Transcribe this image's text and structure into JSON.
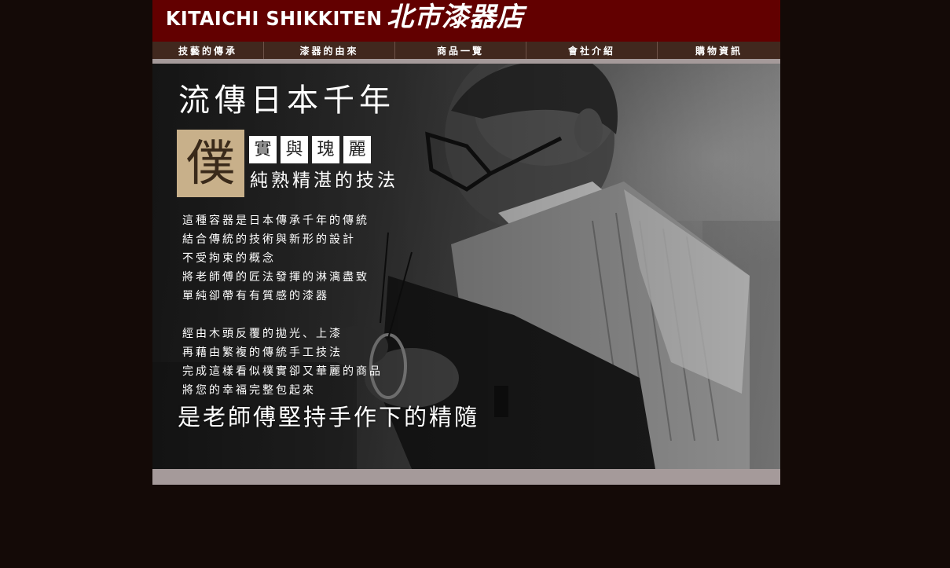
{
  "banner": {
    "brand_en": "KITAICHI SHIKKITEN",
    "brand_jp": "北市漆器店"
  },
  "nav": {
    "items": [
      {
        "label": "技藝的傳承"
      },
      {
        "label": "漆器的由來"
      },
      {
        "label": "商品一覽"
      },
      {
        "label": "會社介紹"
      },
      {
        "label": "購物資訊"
      }
    ]
  },
  "hero": {
    "heading": "流傳日本千年",
    "seal_char": "僕",
    "boxed_chars": [
      "實",
      "與",
      "瑰",
      "麗"
    ],
    "subtitle": "純熟精湛的技法",
    "paragraph1": [
      "這種容器是日本傳承千年的傳統",
      "結合傳統的技術與新形的設計",
      "不受拘束的概念",
      "將老師傅的匠法發揮的淋漓盡致",
      "單純卻帶有有質感的漆器"
    ],
    "paragraph2": [
      "經由木頭反覆的拋光、上漆",
      "再藉由繁複的傳統手工技法",
      "完成這樣看似樸實卻又華麗的商品",
      "將您的幸福完整包起來"
    ],
    "closing": "是老師傅堅持手作下的精隨"
  },
  "colors": {
    "page_background": "#140a07",
    "banner": "#620000",
    "nav_bar": "#41281e",
    "footer_bar": "#a59a9a",
    "seal": "#c8b08a"
  },
  "icons": {
    "hero_image": "craftsman-photo"
  }
}
